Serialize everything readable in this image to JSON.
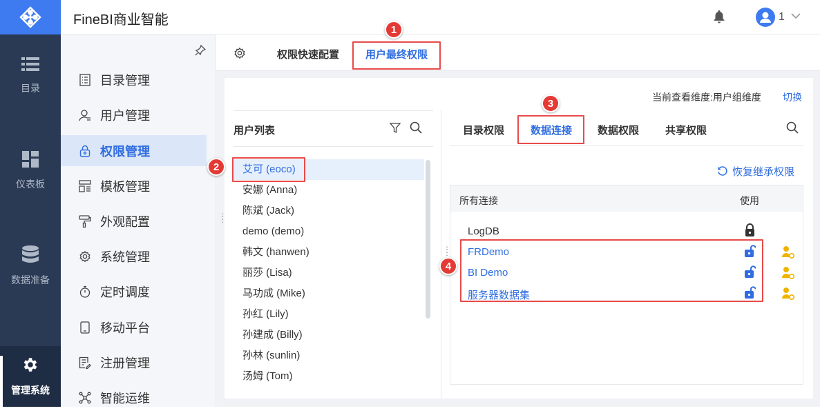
{
  "app": {
    "title": "FineBI商业智能",
    "user_name": "1"
  },
  "rail": [
    {
      "label": "目录",
      "icon": "list-icon"
    },
    {
      "label": "仪表板",
      "icon": "dashboard-icon"
    },
    {
      "label": "数据准备",
      "icon": "database-icon"
    },
    {
      "label": "管理系统",
      "icon": "gear-icon",
      "active": true
    }
  ],
  "nav": [
    {
      "label": "目录管理",
      "icon": "catalog-icon"
    },
    {
      "label": "用户管理",
      "icon": "user-icon"
    },
    {
      "label": "权限管理",
      "icon": "lock-icon",
      "active": true
    },
    {
      "label": "模板管理",
      "icon": "template-icon"
    },
    {
      "label": "外观配置",
      "icon": "brush-icon"
    },
    {
      "label": "系统管理",
      "icon": "gear-icon"
    },
    {
      "label": "定时调度",
      "icon": "timer-icon"
    },
    {
      "label": "移动平台",
      "icon": "mobile-icon"
    },
    {
      "label": "注册管理",
      "icon": "register-icon"
    },
    {
      "label": "智能运维",
      "icon": "network-icon"
    }
  ],
  "tabs": {
    "quick": "权限快速配置",
    "final": "用户最终权限"
  },
  "dimension": {
    "label": "当前查看维度:用户组维度",
    "switch": "切换"
  },
  "user_list": {
    "title": "用户列表",
    "users": [
      "艾可 (eoco)",
      "安娜 (Anna)",
      "陈斌 (Jack)",
      "demo (demo)",
      "韩文 (hanwen)",
      "丽莎 (Lisa)",
      "马功成 (Mike)",
      "孙红 (Lily)",
      "孙建成 (Billy)",
      "孙林 (sunlin)",
      "汤姆 (Tom)"
    ],
    "selected_index": 0
  },
  "sub_tabs": [
    "目录权限",
    "数据连接",
    "数据权限",
    "共享权限"
  ],
  "active_sub_tab": 1,
  "restore": "恢复继承权限",
  "table": {
    "header_connections": "所有连接",
    "header_use": "使用",
    "rows": [
      {
        "name": "LogDB",
        "locked": true
      },
      {
        "name": "FRDemo",
        "locked": false
      },
      {
        "name": "BI Demo",
        "locked": false
      },
      {
        "name": "服务器数据集",
        "locked": false
      }
    ]
  },
  "annotations": [
    "1",
    "2",
    "3",
    "4"
  ],
  "colors": {
    "accent": "#2f6de0",
    "rail": "#2b3a54",
    "logo_bg": "#3e7bf0",
    "callout": "#e53935",
    "lock_open": "#2f6de0",
    "permission_icon": "#f0b400"
  }
}
